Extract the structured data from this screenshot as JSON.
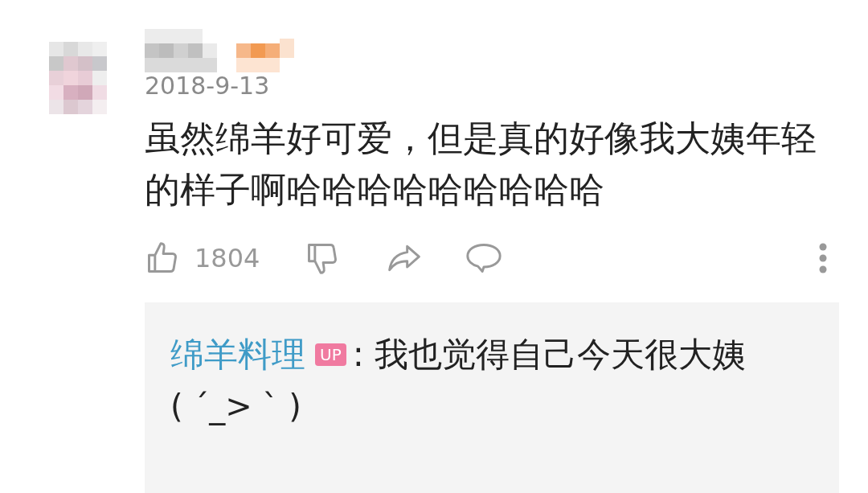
{
  "comment": {
    "date": "2018-9-13",
    "text": "虽然绵羊好可爱，但是真的好像我大姨年轻的样子啊哈哈哈哈哈哈哈哈哈",
    "like_count": "1804",
    "reply": {
      "author": "绵羊料理",
      "badge": "UP",
      "text": ": 我也觉得自己今天很大姨",
      "text_2": "( ´_> ` )"
    }
  }
}
